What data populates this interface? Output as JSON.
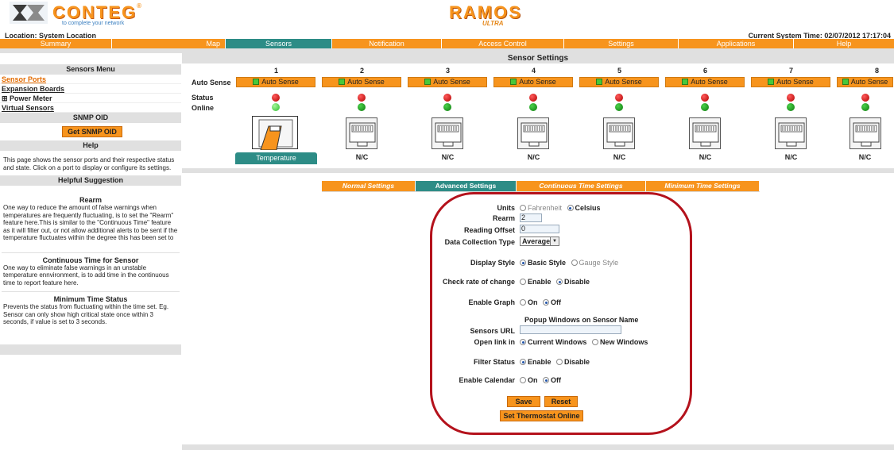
{
  "header": {
    "brand": "CONTEG",
    "brand_tagline": "to complete your network",
    "product_name": "RAMOS",
    "product_sub": "ULTRA",
    "location_text": "Location: System Location",
    "system_time_text": "Current System Time: 02/07/2012 17:17:04"
  },
  "nav": {
    "tabs": [
      {
        "label": "Summary"
      },
      {
        "label": "Map"
      },
      {
        "label": "Sensors"
      },
      {
        "label": "Notification"
      },
      {
        "label": "Access Control"
      },
      {
        "label": "Settings"
      },
      {
        "label": "Applications"
      },
      {
        "label": "Help"
      }
    ],
    "active": "Sensors"
  },
  "sidebar": {
    "menu_title": "Sensors Menu",
    "items": [
      {
        "label": "Sensor Ports"
      },
      {
        "label": "Expansion Boards"
      },
      {
        "label": "⊞ Power Meter"
      },
      {
        "label": "Virtual Sensors"
      }
    ],
    "snmp_title": "SNMP OID",
    "snmp_button": "Get SNMP OID",
    "help_title": "Help",
    "help_text": "This page shows the sensor ports and their respective status and state. Click on a port to display or configure its settings.",
    "suggestion_title": "Helpful Suggestion",
    "suggestions": [
      {
        "title": "Rearm",
        "text": "One way to reduce the amount of false warnings when temperatures are frequently fluctuating, is to set the \"Rearm\" feature here.This is similar to the \"Continuous Time\" feature as it will filter out, or not allow additional alerts to be sent if the temperature fluctuates within the degree this has been set to"
      },
      {
        "title": "Continuous Time for Sensor",
        "text": "One way to eliminate false warnings in an unstable temperature ennvironment, is to add time in the continuous time to report feature here."
      },
      {
        "title": "Minimum Time Status",
        "text": "Prevents the status from fluctuating within the time set. Eg. Sensor can only show high critical state once within 3 seconds, if value is set to 3 seconds."
      }
    ]
  },
  "sensors": {
    "title": "Sensor Settings",
    "row_labels": {
      "auto_sense": "Auto Sense",
      "status": "Status",
      "online": "Online"
    },
    "ports": [
      {
        "number": "1",
        "auto_sense": "Auto Sense",
        "status_color": "red",
        "online_color": "light-green",
        "label": "Temperature",
        "connected": true
      },
      {
        "number": "2",
        "auto_sense": "Auto Sense",
        "status_color": "red",
        "online_color": "green",
        "label": "N/C",
        "connected": false
      },
      {
        "number": "3",
        "auto_sense": "Auto Sense",
        "status_color": "red",
        "online_color": "green",
        "label": "N/C",
        "connected": false
      },
      {
        "number": "4",
        "auto_sense": "Auto Sense",
        "status_color": "red",
        "online_color": "green",
        "label": "N/C",
        "connected": false
      },
      {
        "number": "5",
        "auto_sense": "Auto Sense",
        "status_color": "red",
        "online_color": "green",
        "label": "N/C",
        "connected": false
      },
      {
        "number": "6",
        "auto_sense": "Auto Sense",
        "status_color": "red",
        "online_color": "green",
        "label": "N/C",
        "connected": false
      },
      {
        "number": "7",
        "auto_sense": "Auto Sense",
        "status_color": "red",
        "online_color": "green",
        "label": "N/C",
        "connected": false
      },
      {
        "number": "8",
        "auto_sense": "Auto Sense",
        "status_color": "red",
        "online_color": "green",
        "label": "N/C",
        "connected": false
      }
    ]
  },
  "subtabs": {
    "tabs": [
      {
        "label": "Normal Settings"
      },
      {
        "label": "Advanced Settings"
      },
      {
        "label": "Continuous Time Settings"
      },
      {
        "label": "Minimum Time Settings"
      }
    ],
    "active": "Advanced Settings"
  },
  "form": {
    "units": {
      "label": "Units",
      "opt1": "Fahrenheit",
      "opt2": "Celsius",
      "selected": "Celsius"
    },
    "rearm": {
      "label": "Rearm",
      "value": "2"
    },
    "reading_offset": {
      "label": "Reading Offset",
      "value": "0"
    },
    "collection": {
      "label": "Data Collection Type",
      "value": "Average"
    },
    "display_style": {
      "label": "Display Style",
      "opt1": "Basic Style",
      "opt2": "Gauge Style",
      "selected": "Basic Style"
    },
    "rate_of_change": {
      "label": "Check rate of change",
      "opt1": "Enable",
      "opt2": "Disable",
      "selected": "Disable"
    },
    "graph": {
      "label": "Enable Graph",
      "opt1": "On",
      "opt2": "Off",
      "selected": "Off"
    },
    "popup_label": "Popup Windows on Sensor Name",
    "sensors_url": {
      "label": "Sensors URL",
      "value": ""
    },
    "open_link": {
      "label": "Open link in",
      "opt1": "Current Windows",
      "opt2": "New Windows",
      "selected": "Current Windows"
    },
    "filter_status": {
      "label": "Filter Status",
      "opt1": "Enable",
      "opt2": "Disable",
      "selected": "Enable"
    },
    "calendar": {
      "label": "Enable Calendar",
      "opt1": "On",
      "opt2": "Off",
      "selected": "Off"
    },
    "save_label": "Save",
    "reset_label": "Reset",
    "thermostat_label": "Set Thermostat Online"
  },
  "colors": {
    "accent": "#f7941d",
    "active_tab": "#2d8c86",
    "highlight_oval": "#b4121c"
  }
}
